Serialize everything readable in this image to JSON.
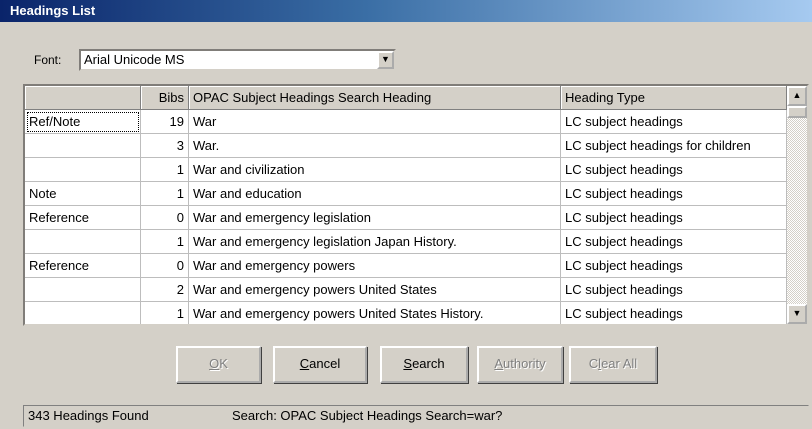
{
  "window": {
    "title": "Headings List"
  },
  "font": {
    "label": "Font:",
    "value": "Arial Unicode MS"
  },
  "table": {
    "columns": [
      "",
      "Bibs",
      "OPAC Subject Headings Search Heading",
      "Heading Type"
    ],
    "rows": [
      {
        "note": "Ref/Note",
        "bibs": "19",
        "heading": "War",
        "type": "LC subject headings"
      },
      {
        "note": "",
        "bibs": "3",
        "heading": "War.",
        "type": "LC subject headings for children"
      },
      {
        "note": "",
        "bibs": "1",
        "heading": "War and civilization",
        "type": "LC subject headings"
      },
      {
        "note": "Note",
        "bibs": "1",
        "heading": "War and education",
        "type": "LC subject headings"
      },
      {
        "note": "Reference",
        "bibs": "0",
        "heading": "War and emergency legislation",
        "type": "LC subject headings"
      },
      {
        "note": "",
        "bibs": "1",
        "heading": "War and emergency legislation Japan History.",
        "type": "LC subject headings"
      },
      {
        "note": "Reference",
        "bibs": "0",
        "heading": "War and emergency powers",
        "type": "LC subject headings"
      },
      {
        "note": "",
        "bibs": "2",
        "heading": "War and emergency powers United States",
        "type": "LC subject headings"
      },
      {
        "note": "",
        "bibs": "1",
        "heading": "War and emergency powers United States History.",
        "type": "LC subject headings"
      }
    ]
  },
  "buttons": {
    "ok": {
      "mnemonic": "O",
      "rest": "K"
    },
    "cancel": {
      "mnemonic": "C",
      "rest": "ancel"
    },
    "search": {
      "mnemonic": "S",
      "rest": "earch"
    },
    "authority": {
      "mnemonic": "A",
      "rest": "uthority"
    },
    "clear_all": {
      "pre": "C",
      "mnemonic": "l",
      "rest": "ear All"
    }
  },
  "status": {
    "count": "343 Headings Found",
    "search": "Search: OPAC Subject Headings Search=war?"
  },
  "icons": {
    "dropdown": "▼",
    "scroll_up": "▲",
    "scroll_down": "▼"
  }
}
